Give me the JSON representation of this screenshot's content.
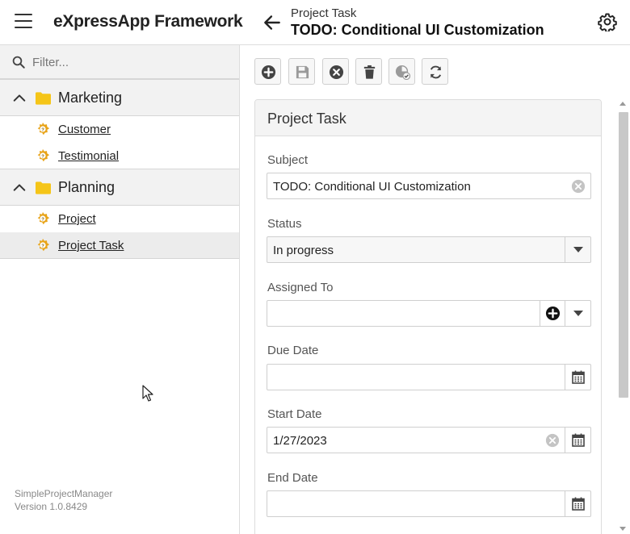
{
  "app": {
    "title": "eXpressApp Framework"
  },
  "header": {
    "breadcrumb": "Project Task",
    "view_title": "TODO: Conditional UI Customization"
  },
  "sidebar": {
    "filter_placeholder": "Filter...",
    "groups": [
      {
        "label": "Marketing",
        "items": [
          {
            "label": "Customer"
          },
          {
            "label": "Testimonial"
          }
        ]
      },
      {
        "label": "Planning",
        "items": [
          {
            "label": "Project"
          },
          {
            "label": "Project Task",
            "selected": true
          }
        ]
      }
    ],
    "footer": {
      "app_name": "SimpleProjectManager",
      "version": "Version 1.0.8429"
    }
  },
  "toolbar": {
    "buttons": [
      "add-icon",
      "save-icon",
      "cancel-icon",
      "delete-icon",
      "validate-icon",
      "refresh-icon"
    ]
  },
  "detail": {
    "panel_title": "Project Task",
    "fields": {
      "subject": {
        "label": "Subject",
        "value": "TODO: Conditional UI Customization"
      },
      "status": {
        "label": "Status",
        "value": "In progress"
      },
      "assigned_to": {
        "label": "Assigned To",
        "value": ""
      },
      "due_date": {
        "label": "Due Date",
        "value": ""
      },
      "start_date": {
        "label": "Start Date",
        "value": "1/27/2023"
      },
      "end_date": {
        "label": "End Date",
        "value": ""
      }
    }
  },
  "colors": {
    "folder": "#f5c518",
    "business_object": "#e8a317",
    "scroll_thumb": "#c8c8c8"
  }
}
